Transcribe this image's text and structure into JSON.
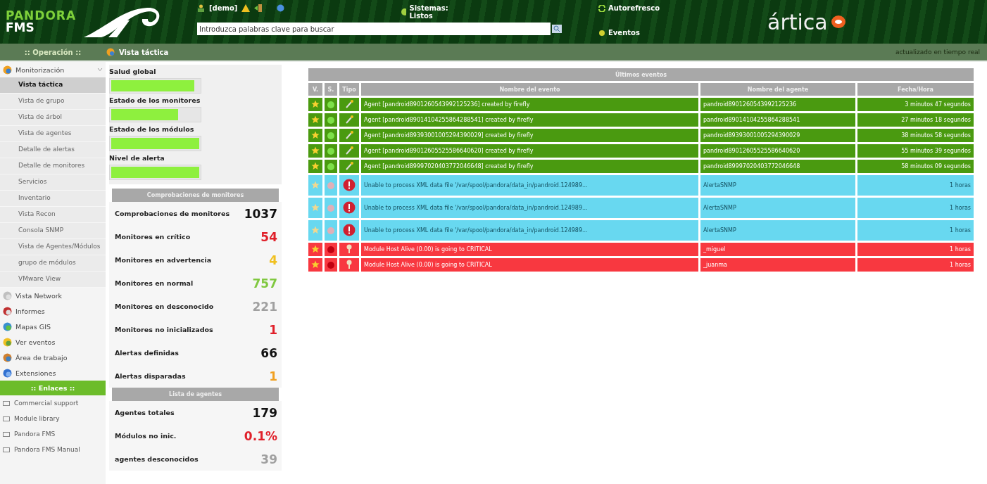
{
  "header": {
    "logo": {
      "line_1": "PANDORA",
      "line_2": "FMS"
    },
    "user": "[demo]",
    "search": {
      "placeholder": "Introduzca palabras clave para buscar"
    },
    "status": "Sistemas: Listos",
    "links": [
      "Autorefresco",
      "Eventos"
    ],
    "brand": "ártica"
  },
  "navbar": {
    "section": ":: Operación ::",
    "page": "Vista táctica",
    "note": "actualizado en tiempo real"
  },
  "sidebar": {
    "items": [
      {
        "label": "Monitorización",
        "kind": "monitor",
        "expanded": true,
        "children": [
          {
            "label": "Vista táctica",
            "selected": true
          },
          {
            "label": "Vista de grupo",
            "selected": false
          },
          {
            "label": "Vista de árbol",
            "selected": false
          },
          {
            "label": "Vista de agentes",
            "selected": false
          },
          {
            "label": "Detalle de alertas",
            "selected": false
          },
          {
            "label": "Detalle de monitores",
            "selected": false
          },
          {
            "label": "Servicios",
            "selected": false
          },
          {
            "label": "Inventario",
            "selected": false
          },
          {
            "label": "Vista Recon",
            "selected": false
          },
          {
            "label": "Consola SNMP",
            "selected": false
          },
          {
            "label": "Vista de Agentes/Módulos",
            "selected": false
          },
          {
            "label": "grupo de módulos",
            "selected": false
          },
          {
            "label": "VMware View",
            "selected": false
          }
        ]
      },
      {
        "label": "Vista Network",
        "kind": "network"
      },
      {
        "label": "Informes",
        "kind": "report"
      },
      {
        "label": "Mapas GIS",
        "kind": "globe"
      },
      {
        "label": "Ver eventos",
        "kind": "events"
      },
      {
        "label": "Área de trabajo",
        "kind": "workspace"
      },
      {
        "label": "Extensiones",
        "kind": "extension"
      }
    ],
    "links_title": ":: Enlaces ::",
    "links": [
      "Commercial support",
      "Module library",
      "Pandora FMS",
      "Pandora FMS Manual"
    ]
  },
  "gauges": [
    {
      "label": "Salud global",
      "level": 0.94
    },
    {
      "label": "Estado de los monitores",
      "level": 0.76
    },
    {
      "label": "Estado de los módulos",
      "level": 1
    },
    {
      "label": "Nivel de alerta",
      "level": 1
    }
  ],
  "monitor_checks": {
    "title": "Comprobaciones de monitores",
    "rows": [
      {
        "label": "Comprobaciones de monitores",
        "value": "1037",
        "color": "#111111"
      },
      {
        "label": "Monitores en crítico",
        "value": "54",
        "color": "#e0202a"
      },
      {
        "label": "Monitores en advertencia",
        "value": "4",
        "color": "#f0c020"
      },
      {
        "label": "Monitores en normal",
        "value": "757",
        "color": "#80c840"
      },
      {
        "label": "Monitores en desconocido",
        "value": "221",
        "color": "#a0a0a0"
      },
      {
        "label": "Monitores no inicializados",
        "value": "1",
        "color": "#e0202a"
      },
      {
        "label": "Alertas definidas",
        "value": "66",
        "color": "#111111"
      },
      {
        "label": "Alertas disparadas",
        "value": "1",
        "color": "#f0a020"
      }
    ]
  },
  "agent_list": {
    "title": "Lista de agentes",
    "rows": [
      {
        "label": "Agentes totales",
        "value": "179",
        "color": "#111111"
      },
      {
        "label": "Módulos no inic.",
        "value": "0.1%",
        "color": "#e0202a"
      },
      {
        "label": "agentes desconocidos",
        "value": "39",
        "color": "#a0a0a0"
      }
    ]
  },
  "events": {
    "title": "Últimos eventos",
    "columns": [
      "V.",
      "S.",
      "Tipo",
      "Nombre del evento",
      "Nombre del agente",
      "Fecha/Hora"
    ],
    "rows": [
      {
        "kind": "agent",
        "validated": true,
        "color": "#7ee048",
        "event": "Agent [pandroid8901260543992125236] created by firefly",
        "agent": "pandroid8901260543992125236",
        "time": "3 minutos 47 segundos"
      },
      {
        "kind": "agent",
        "validated": true,
        "color": "#7ee048",
        "event": "Agent [pandroid89014104255864288541] created by firefly",
        "agent": "pandroid89014104255864288541",
        "time": "27 minutos 18 segundos"
      },
      {
        "kind": "agent",
        "validated": true,
        "color": "#7ee048",
        "event": "Agent [pandroid89393001005294390029] created by firefly",
        "agent": "pandroid89393001005294390029",
        "time": "38 minutos 58 segundos"
      },
      {
        "kind": "agent",
        "validated": true,
        "color": "#7ee048",
        "event": "Agent [pandroid89012605525586640620] created by firefly",
        "agent": "pandroid89012605525586640620",
        "time": "55 minutos 39 segundos"
      },
      {
        "kind": "agent",
        "validated": true,
        "color": "#7ee048",
        "event": "Agent [pandroid89997020403772046648] created by firefly",
        "agent": "pandroid89997020403772046648",
        "time": "58 minutos 09 segundos"
      },
      {
        "kind": "error",
        "validated": false,
        "color": "#e0b0b8",
        "event": "Unable to process XML data file '/var/spool/pandora/data_in/pandroid.124989...",
        "agent": "AlertaSNMP",
        "time": "1 horas"
      },
      {
        "kind": "error",
        "validated": false,
        "color": "#e0b0b8",
        "event": "Unable to process XML data file '/var/spool/pandora/data_in/pandroid.124989...",
        "agent": "AlertaSNMP",
        "time": "1 horas"
      },
      {
        "kind": "error",
        "validated": false,
        "color": "#e0b0b8",
        "event": "Unable to process XML data file '/var/spool/pandora/data_in/pandroid.124989...",
        "agent": "AlertaSNMP",
        "time": "1 horas"
      },
      {
        "kind": "module",
        "validated": true,
        "color": "#c00010",
        "event": "Module Host Alive (0.00) is going to CRITICAL",
        "agent": "_miguel",
        "time": "1 horas"
      },
      {
        "kind": "module",
        "validated": true,
        "color": "#c00010",
        "event": "Module Host Alive (0.00) is going to CRITICAL",
        "agent": "_juanma",
        "time": "1 horas"
      }
    ]
  }
}
